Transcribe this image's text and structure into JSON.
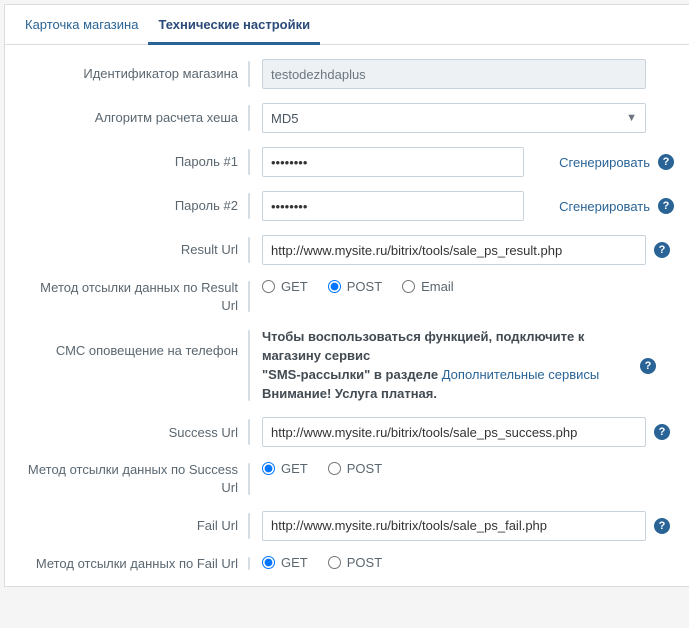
{
  "tabs": {
    "card": "Карточка магазина",
    "tech": "Технические настройки"
  },
  "labels": {
    "store_id": "Идентификатор магазина",
    "hash_algo": "Алгоритм расчета хеша",
    "password1": "Пароль #1",
    "password2": "Пароль #2",
    "result_url": "Result Url",
    "result_method": "Метод отсылки данных по Result Url",
    "sms_notify": "СМС оповещение на телефон",
    "success_url": "Success Url",
    "success_method": "Метод отсылки данных по Success Url",
    "fail_url": "Fail Url",
    "fail_method": "Метод отсылки данных по Fail Url"
  },
  "values": {
    "store_id": "testodezhdaplus",
    "hash_algo": "MD5",
    "password1": "••••••••",
    "password2": "••••••••",
    "result_url": "http://www.mysite.ru/bitrix/tools/sale_ps_result.php",
    "success_url": "http://www.mysite.ru/bitrix/tools/sale_ps_success.php",
    "fail_url": "http://www.mysite.ru/bitrix/tools/sale_ps_fail.php"
  },
  "actions": {
    "generate": "Сгенерировать"
  },
  "radio": {
    "get": "GET",
    "post": "POST",
    "email": "Email"
  },
  "sms": {
    "line1_a": "Чтобы воспользоваться функцией, подключите к магазину сервис",
    "line2_a": "\"SMS-рассылки\" в разделе ",
    "link": "Дополнительные сервисы",
    "line3": "Внимание! Услуга платная."
  },
  "help_glyph": "?"
}
